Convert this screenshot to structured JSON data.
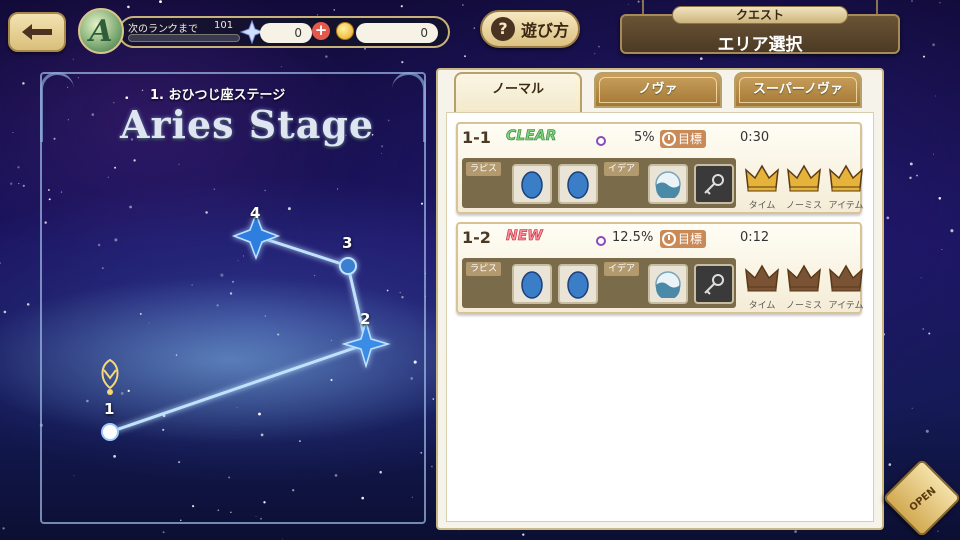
{
  "header": {
    "back_icon": "left-arrow-icon",
    "rank_letter": "A",
    "rank_next_label": "次のランクまで",
    "rank_next_value": "101",
    "crystal_count": "0",
    "coin_count": "0",
    "help_label": "遊び方",
    "quest_tag": "クエスト",
    "quest_title": "エリア選択"
  },
  "stage": {
    "subtitle": "1. おひつじ座ステージ",
    "title": "Aries Stage",
    "nodes": [
      "1",
      "2",
      "3",
      "4"
    ]
  },
  "tabs": [
    {
      "label": "ノーマル",
      "active": true
    },
    {
      "label": "ノヴァ",
      "active": false
    },
    {
      "label": "スーパーノヴァ",
      "active": false
    }
  ],
  "cards": [
    {
      "num": "1-1",
      "badge": "CLEAR",
      "pct": "5%",
      "goal_label": "目標",
      "goal_time": "0:30",
      "lapis_tag": "ラピス",
      "idea_tag": "イデア",
      "crown_labels": [
        "タイム",
        "ノーミス",
        "アイテム"
      ],
      "crown_state": "gold"
    },
    {
      "num": "1-2",
      "badge": "NEW",
      "pct": "12.5%",
      "goal_label": "目標",
      "goal_time": "0:12",
      "lapis_tag": "ラピス",
      "idea_tag": "イデア",
      "crown_labels": [
        "タイム",
        "ノーミス",
        "アイテム"
      ],
      "crown_state": "bronze"
    }
  ],
  "open_label": "OPEN",
  "colors": {
    "gold_crown": "#e5b23a",
    "bronze_crown": "#7a5236",
    "tab_active": "#f8f1da",
    "accent": "#c98a58"
  }
}
